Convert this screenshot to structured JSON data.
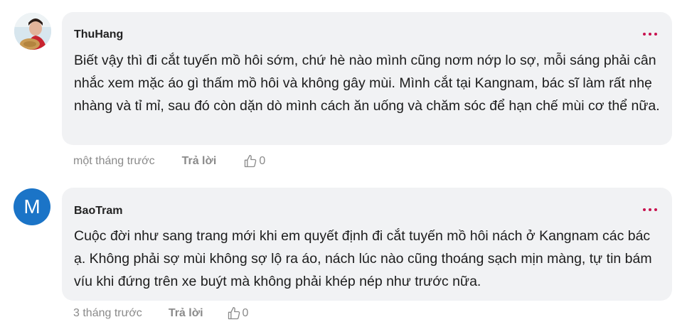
{
  "comments": [
    {
      "author": "ThuHang",
      "avatar_icon": "user-photo-avatar",
      "text": "Biết vậy thì đi cắt tuyến mồ hôi sớm, chứ hè nào mình cũng nơm nớp lo sợ, mỗi sáng phải cân nhắc xem mặc áo gì thấm mồ hôi và không gây mùi. Mình cắt tại Kangnam, bác sĩ làm rất nhẹ nhàng và tỉ mỉ, sau đó còn dặn dò mình cách ăn uống và chăm sóc để hạn chế mùi cơ thể nữa.",
      "time": "một tháng trước",
      "reply_label": "Trả lời",
      "likes": "0"
    },
    {
      "author": "BaoTram",
      "avatar_letter": "M",
      "avatar_color": "#1b74c7",
      "text": "Cuộc đời như sang trang mới khi em quyết định đi cắt tuyến mồ hôi nách ở Kangnam các bác ạ. Không phải sợ mùi không sợ lộ ra áo, nách lúc nào cũng thoáng sạch mịn màng, tự tin bám víu khi đứng trên xe buýt mà không phải khép nép như trước nữa.",
      "time": "3 tháng trước",
      "reply_label": "Trả lời",
      "likes": "0"
    }
  ],
  "accent_color": "#c8124f"
}
